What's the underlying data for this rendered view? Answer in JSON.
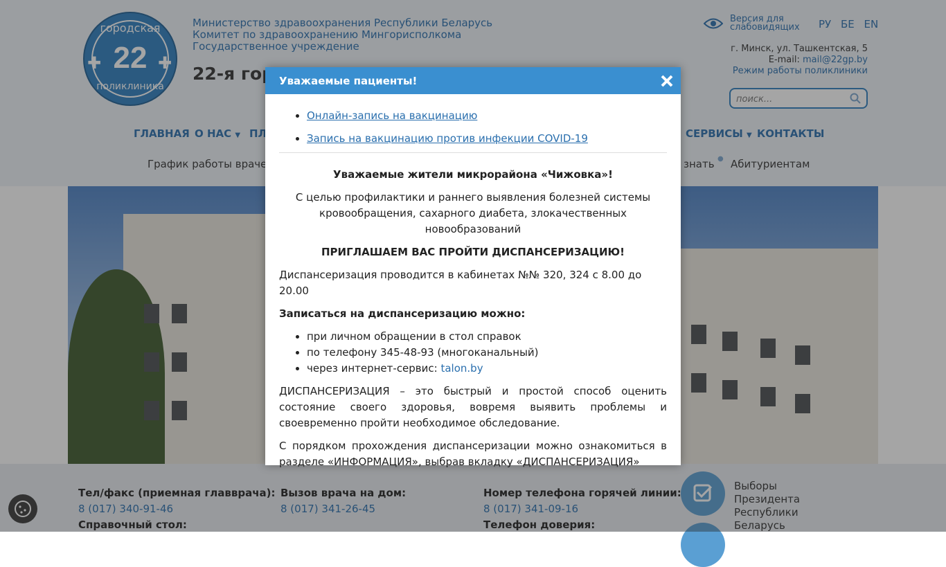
{
  "header": {
    "logo": {
      "top": "городская",
      "number": "22",
      "bottom": "поликлиника"
    },
    "org_lines": [
      "Министерство здравоохранения Республики Беларусь",
      "Комитет по здравоохранению Мингорисполкома",
      "Государственное учреждение"
    ],
    "site_title_visible": "22-я гор",
    "visually_impaired": "Версия для слабовидящих",
    "languages": [
      "РУ",
      "БЕ",
      "EN"
    ],
    "address": "г. Минск, ул. Ташкентская, 5",
    "email_label": "E-mail:",
    "email": "mail@22gp.by",
    "schedule_link": "Режим работы поликлиники",
    "search_placeholder": "поиск..."
  },
  "main_nav": {
    "home": "ГЛАВНАЯ",
    "about": "О НАС",
    "partial": "ПЛА",
    "services": "СЕРВИСЫ",
    "contacts": "КОНТАКТЫ"
  },
  "sub_nav": {
    "doctors_schedule": "График работы врачей",
    "know_partial": "знать",
    "applicants": "Абитуриентам"
  },
  "footer": {
    "col1": {
      "label1": "Тел/факс (приемная главврача):",
      "value1": "8 (017) 340-91-46",
      "label2": "Справочный стол:"
    },
    "col2": {
      "label1": "Вызов врача на дом:",
      "value1": "8 (017) 341-26-45"
    },
    "col3": {
      "label1": "Номер телефона горячей линии:",
      "value1": "8 (017) 341-09-16",
      "label2": "Телефон доверия:"
    },
    "elections": "Выборы Президента Республики Беларусь"
  },
  "modal": {
    "title": "Уважаемые пациенты!",
    "links": [
      "Онлайн-запись на вакцинацию",
      "Запись на вакцинацию против инфекции COVID-19"
    ],
    "greeting": "Уважаемые жители микрорайона «Чижовка»!",
    "purpose": "С целью профилактики и раннего выявления болезней системы кровообращения, сахарного диабета, злокачественных новообразований",
    "invite": "ПРИГЛАШАЕМ ВАС ПРОЙТИ ДИСПАНСЕРИЗАЦИЮ!",
    "rooms": "Диспансеризация проводится в кабинетах №№ 320, 324 с 8.00 до 20.00",
    "signup_heading": "Записаться на диспансеризацию можно:",
    "options": [
      "при личном обращении в стол справок",
      "по телефону 345-48-93 (многоканальный)",
      "через интернет-сервис:"
    ],
    "talon": "talon.by",
    "description": "ДИСПАНСЕРИЗАЦИЯ – это быстрый и простой способ оценить состояние своего здоровья, вовремя выявить проблемы и своевременно пройти необходимое обследование.",
    "info": "С порядком прохождения диспансеризации можно ознакомиться в разделе «ИНФОРМАЦИЯ», выбрав вкладку «ДИСПАНСЕРИЗАЦИЯ»"
  }
}
